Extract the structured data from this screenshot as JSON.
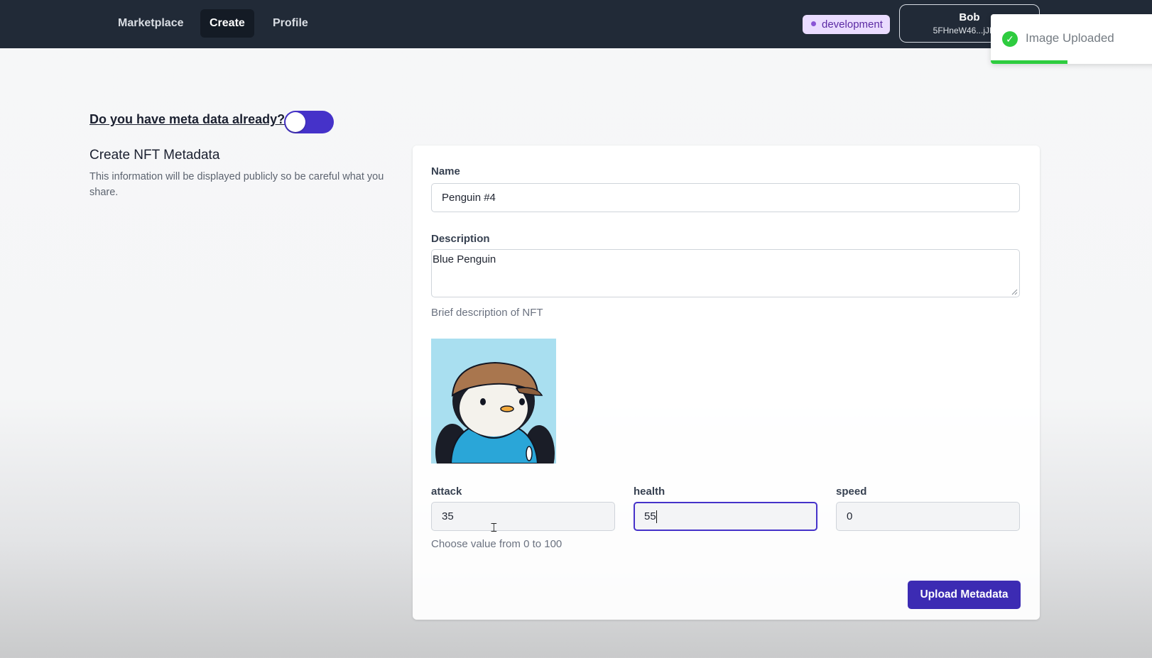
{
  "nav": {
    "items": [
      {
        "label": "Marketplace"
      },
      {
        "label": "Create"
      },
      {
        "label": "Profile"
      }
    ],
    "active": "Create",
    "env_badge": "development",
    "account": {
      "name": "Bob",
      "address": "5FHneW46...jJM69"
    }
  },
  "toast": {
    "message": "Image Uploaded",
    "progress": 0.45,
    "color": "#2ecc3f"
  },
  "toggle": {
    "label": "Do you have meta data already?",
    "on": true
  },
  "section": {
    "title": "Create NFT Metadata",
    "subtitle": "This information will be displayed publicly so be careful what you share."
  },
  "form": {
    "name": {
      "label": "Name",
      "value": "Penguin #4"
    },
    "description": {
      "label": "Description",
      "value": "Blue Penguin",
      "help": "Brief description of NFT"
    },
    "image": {
      "alt_icon": "penguin-image"
    },
    "attributes": [
      {
        "label": "attack",
        "value": "35"
      },
      {
        "label": "health",
        "value": "55"
      },
      {
        "label": "speed",
        "value": "0"
      }
    ],
    "attributes_help": "Choose value from 0 to 100",
    "submit_label": "Upload Metadata"
  },
  "colors": {
    "accent": "#4532c9",
    "button": "#3c2bb3",
    "nav_bg": "#212a37"
  }
}
